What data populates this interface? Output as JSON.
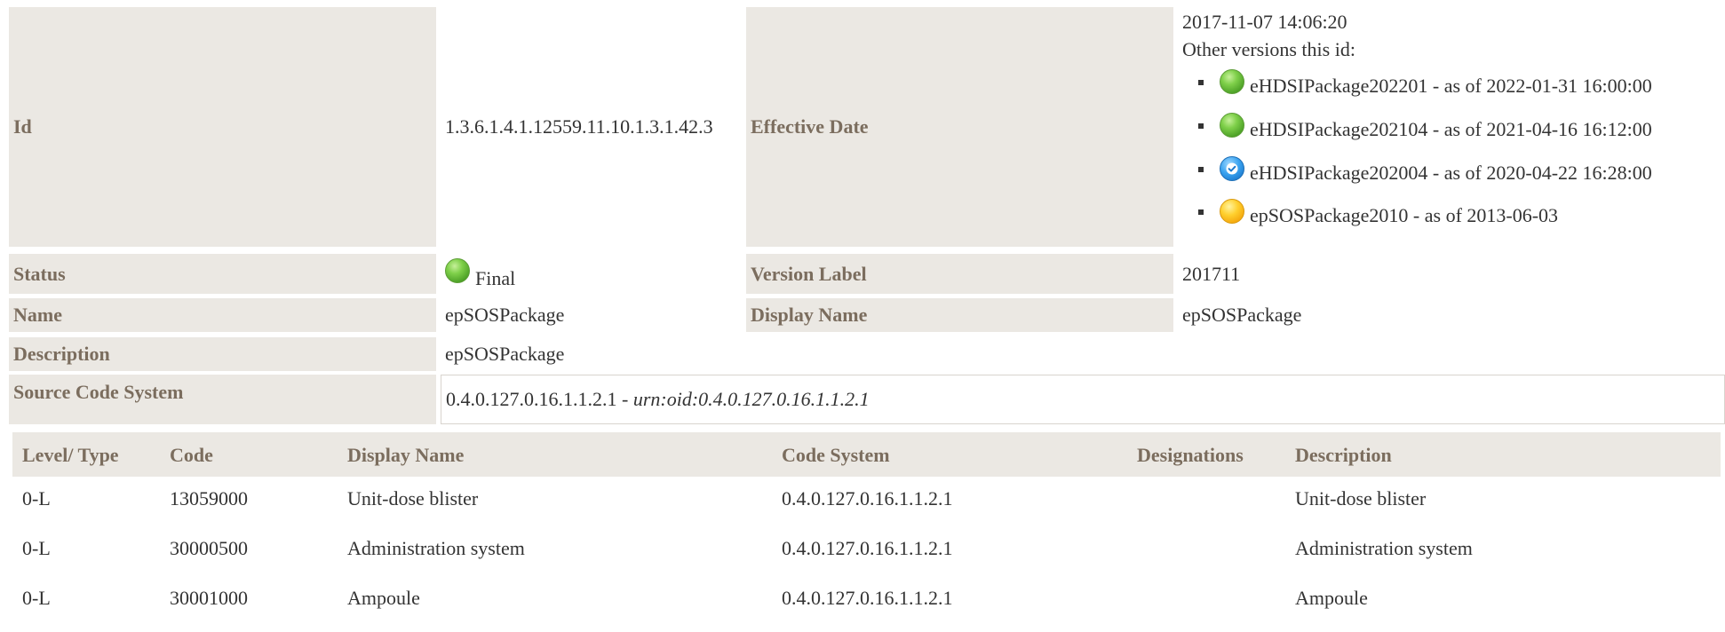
{
  "header": {
    "id_label": "Id",
    "id_value": "1.3.6.1.4.1.12559.11.10.1.3.1.42.3",
    "effective_date_label": "Effective Date",
    "effective_date_value": "2017-11-07 14:06:20",
    "other_versions_label": "Other versions this id:",
    "versions": [
      {
        "text": "eHDSIPackage202201 - as of 2022-01-31 16:00:00",
        "status_icon": "green-circle-icon"
      },
      {
        "text": "eHDSIPackage202104 - as of 2021-04-16 16:12:00",
        "status_icon": "green-circle-icon"
      },
      {
        "text": "eHDSIPackage202004 - as of 2020-04-22 16:28:00",
        "status_icon": "blue-check-circle-icon"
      },
      {
        "text": "epSOSPackage2010 - as of 2013-06-03",
        "status_icon": "yellow-circle-icon"
      }
    ],
    "status_label": "Status",
    "status_value": "Final",
    "status_icon": "green-circle-icon",
    "version_label_label": "Version Label",
    "version_label_value": "201711",
    "name_label": "Name",
    "name_value": "epSOSPackage",
    "display_name_label": "Display Name",
    "display_name_value": "epSOSPackage",
    "description_label": "Description",
    "description_value": "epSOSPackage",
    "source_code_system_label": "Source Code System",
    "source_code_system_value": "0.4.0.127.0.16.1.1.2.1",
    "source_code_system_separator": " - ",
    "source_code_system_urn": "urn:oid:0.4.0.127.0.16.1.1.2.1"
  },
  "table": {
    "columns": [
      "Level/ Type",
      "Code",
      "Display Name",
      "Code System",
      "Designations",
      "Description"
    ],
    "rows": [
      [
        "0-L",
        "13059000",
        "Unit-dose blister",
        "0.4.0.127.0.16.1.1.2.1",
        "",
        "Unit-dose blister"
      ],
      [
        "0-L",
        "30000500",
        "Administration system",
        "0.4.0.127.0.16.1.1.2.1",
        "",
        "Administration system"
      ],
      [
        "0-L",
        "30001000",
        "Ampoule",
        "0.4.0.127.0.16.1.1.2.1",
        "",
        "Ampoule"
      ]
    ]
  },
  "colors": {
    "label_background": "#ebe8e3",
    "label_text": "#7b6d5e",
    "body_text": "#333333"
  }
}
